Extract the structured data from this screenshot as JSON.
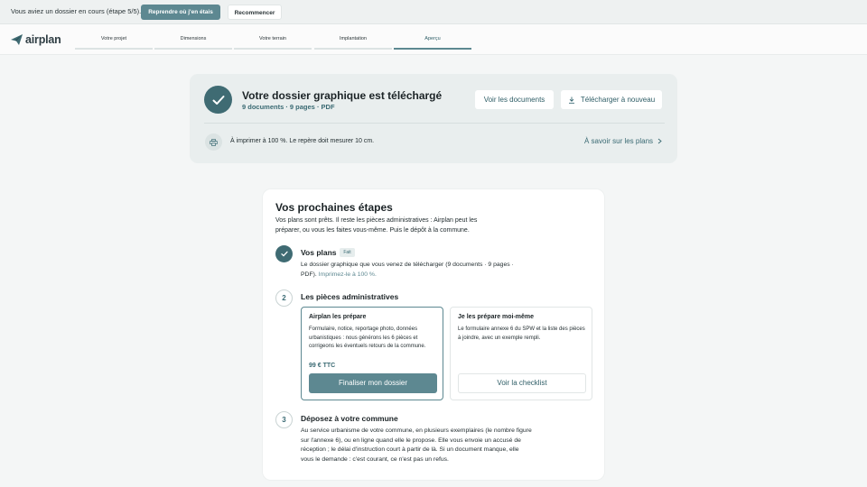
{
  "banner": {
    "text": "Vous aviez un dossier en cours (étape 5/5).",
    "resume_label": "Reprendre où j'en étais",
    "restart_label": "Recommencer"
  },
  "brand": {
    "name": "airplan"
  },
  "steps": [
    {
      "label": "Votre projet"
    },
    {
      "label": "Dimensions"
    },
    {
      "label": "Votre terrain"
    },
    {
      "label": "Implantation"
    },
    {
      "label": "Aperçu",
      "active": true
    }
  ],
  "download": {
    "title": "Votre dossier graphique est téléchargé",
    "subtitle": "9 documents · 9 pages · PDF",
    "view_docs_label": "Voir les documents",
    "redownload_label": "Télécharger à nouveau",
    "print_note": "À imprimer à 100 %. Le repère doit mesurer 10 cm.",
    "plans_link": "À savoir sur les plans"
  },
  "next_steps": {
    "title": "Vos prochaines étapes",
    "intro": "Vos plans sont prêts. Il reste les pièces administratives : Airplan peut les préparer, ou vous les faites vous-même. Puis le dépôt à la commune.",
    "step1": {
      "title": "Vos plans",
      "badge": "Fait",
      "text": "Le dossier graphique que vous venez de télécharger (9 documents · 9 pages · PDF).",
      "link": "Imprimez-le à 100 %."
    },
    "step2": {
      "number": "2",
      "title": "Les pièces administratives",
      "option_a": {
        "title": "Airplan les prépare",
        "desc": "Formulaire, notice, reportage photo, données urbanistiques : nous générons les 6 pièces et corrigeons les éventuels retours de la commune.",
        "price": "99 € TTC",
        "button": "Finaliser mon dossier"
      },
      "option_b": {
        "title": "Je les prépare moi-même",
        "desc": "Le formulaire annexe 6 du SPW et la liste des pièces à joindre, avec un exemple rempli.",
        "button": "Voir la checklist"
      }
    },
    "step3": {
      "number": "3",
      "title": "Déposez à votre commune",
      "text": "Au service urbanisme de votre commune, en plusieurs exemplaires (le nombre figure sur l'annexe 6), ou en ligne quand elle le propose. Elle vous envoie un accusé de réception ; le délai d'instruction court à partir de là. Si un document manque, elle vous le demande : c'est courant, ce n'est pas un refus."
    }
  },
  "colors": {
    "accent": "#5d8891",
    "dark_accent": "#3f6b73"
  }
}
